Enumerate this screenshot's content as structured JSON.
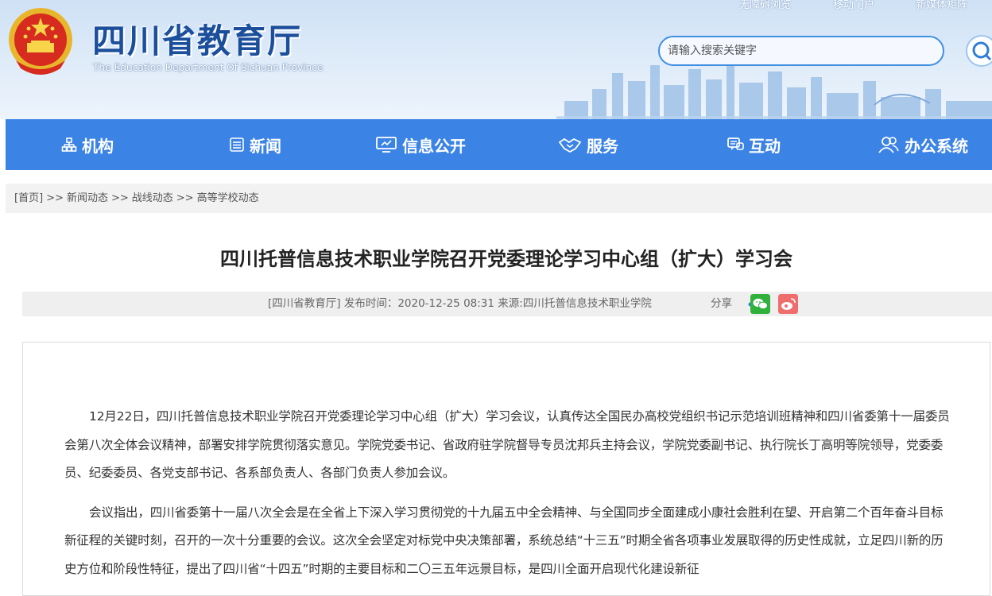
{
  "header": {
    "site_title": "四川省教育厅",
    "site_subtitle": "The Education Department Of Sichuan Province",
    "top_links": [
      "无障碍浏览",
      "移动门户",
      "新媒体矩阵"
    ],
    "search_placeholder": "请输入搜索关键字"
  },
  "nav": {
    "items": [
      {
        "label": "机构",
        "icon": "org-chart-icon"
      },
      {
        "label": "新闻",
        "icon": "newspaper-icon"
      },
      {
        "label": "信息公开",
        "icon": "monitor-icon"
      },
      {
        "label": "服务",
        "icon": "handshake-icon"
      },
      {
        "label": "互动",
        "icon": "chat-icon"
      },
      {
        "label": "办公系统",
        "icon": "users-icon"
      }
    ]
  },
  "breadcrumb": {
    "items": [
      "[首页]",
      "新闻动态",
      "战线动态",
      "高等学校动态"
    ],
    "separator": ">>"
  },
  "article": {
    "title": "四川托普信息技术职业学院召开党委理论学习中心组（扩大）学习会",
    "meta": "[四川省教育厅]   发布时间：2020-12-25 08:31   来源:四川托普信息技术职业学院",
    "share_label": "分享",
    "paragraphs": [
      "12月22日，四川托普信息技术职业学院召开党委理论学习中心组（扩大）学习会议，认真传达全国民办高校党组织书记示范培训班精神和四川省委第十一届委员会第八次全体会议精神，部署安排学院贯彻落实意见。学院党委书记、省政府驻学院督导专员沈邦兵主持会议，学院党委副书记、执行院长丁高明等院领导，党委委员、纪委委员、各党支部书记、各系部负责人、各部门负责人参加会议。",
      "会议指出，四川省委第十一届八次全会是在全省上下深入学习贯彻党的十九届五中全会精神、与全国同步全面建成小康社会胜利在望、开启第二个百年奋斗目标新征程的关键时刻，召开的一次十分重要的会议。这次全会坚定对标党中央决策部署，系统总结“十三五”时期全省各项事业发展取得的历史性成就，立足四川新的历史方位和阶段性特征，提出了四川省“十四五”时期的主要目标和二〇三五年远景目标，是四川全面开启现代化建设新征"
    ]
  },
  "colors": {
    "nav_bg": "#3c83e6",
    "title_blue": "#1b4f9c",
    "wechat": "#2fb13c",
    "weibo": "#f06d6d"
  }
}
